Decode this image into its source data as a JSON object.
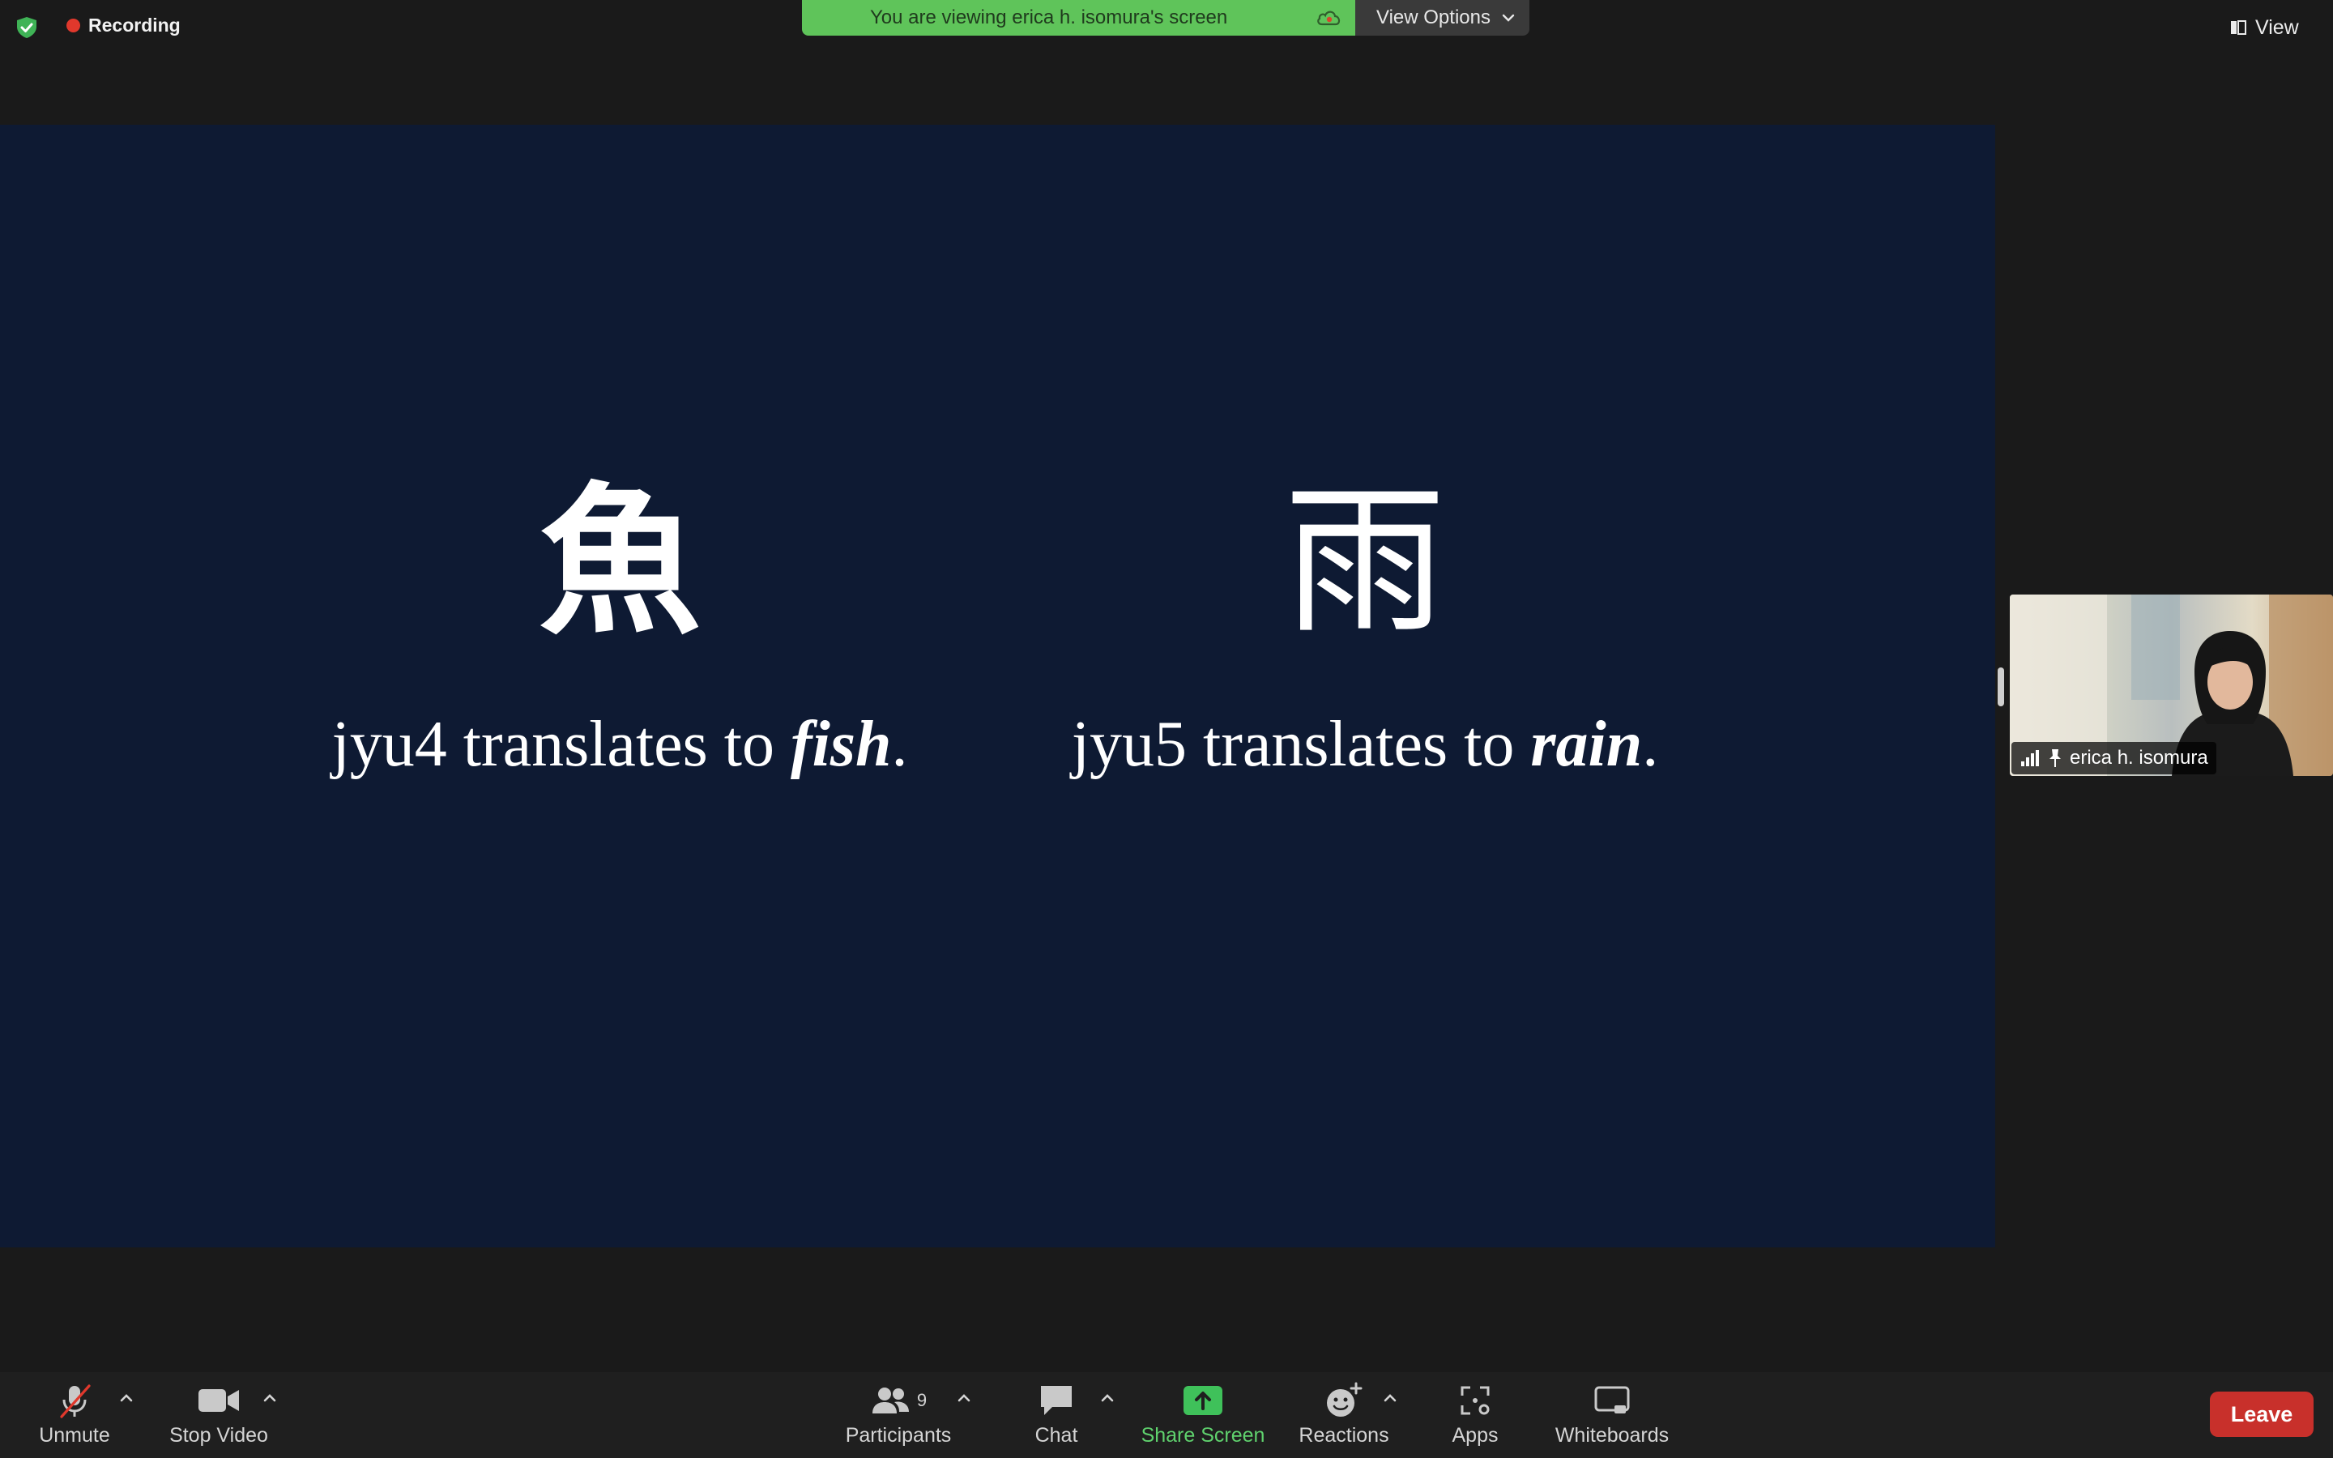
{
  "top_bar": {
    "recording_label": "Recording",
    "banner_text": "You are viewing erica h. isomura's screen",
    "view_options_label": "View Options",
    "view_label": "View"
  },
  "slide": {
    "left": {
      "character": "魚",
      "prefix": "jyu4 translates to ",
      "word": "fish",
      "suffix": "."
    },
    "right": {
      "character": "雨",
      "prefix": "jyu5 translates to ",
      "word": "rain",
      "suffix": "."
    }
  },
  "participant_tile": {
    "name": "erica h. isomura"
  },
  "toolbar": {
    "unmute": "Unmute",
    "stop_video": "Stop Video",
    "participants": "Participants",
    "participants_count": "9",
    "chat": "Chat",
    "share_screen": "Share Screen",
    "reactions": "Reactions",
    "apps": "Apps",
    "whiteboards": "Whiteboards",
    "leave": "Leave"
  },
  "colors": {
    "banner_green": "#5fc45a",
    "slide_background": "#0e1a33",
    "leave_red": "#c8302b",
    "share_green": "#5fd16d",
    "recording_red": "#e0382c"
  },
  "icons": [
    "shield-check-icon",
    "recording-dot-icon",
    "cloud-icon",
    "chevron-down-icon",
    "view-icon",
    "signal-icon",
    "pin-icon",
    "mic-muted-icon",
    "video-camera-icon",
    "participants-icon",
    "chat-icon",
    "share-screen-icon",
    "reactions-icon",
    "apps-icon",
    "whiteboard-icon"
  ]
}
